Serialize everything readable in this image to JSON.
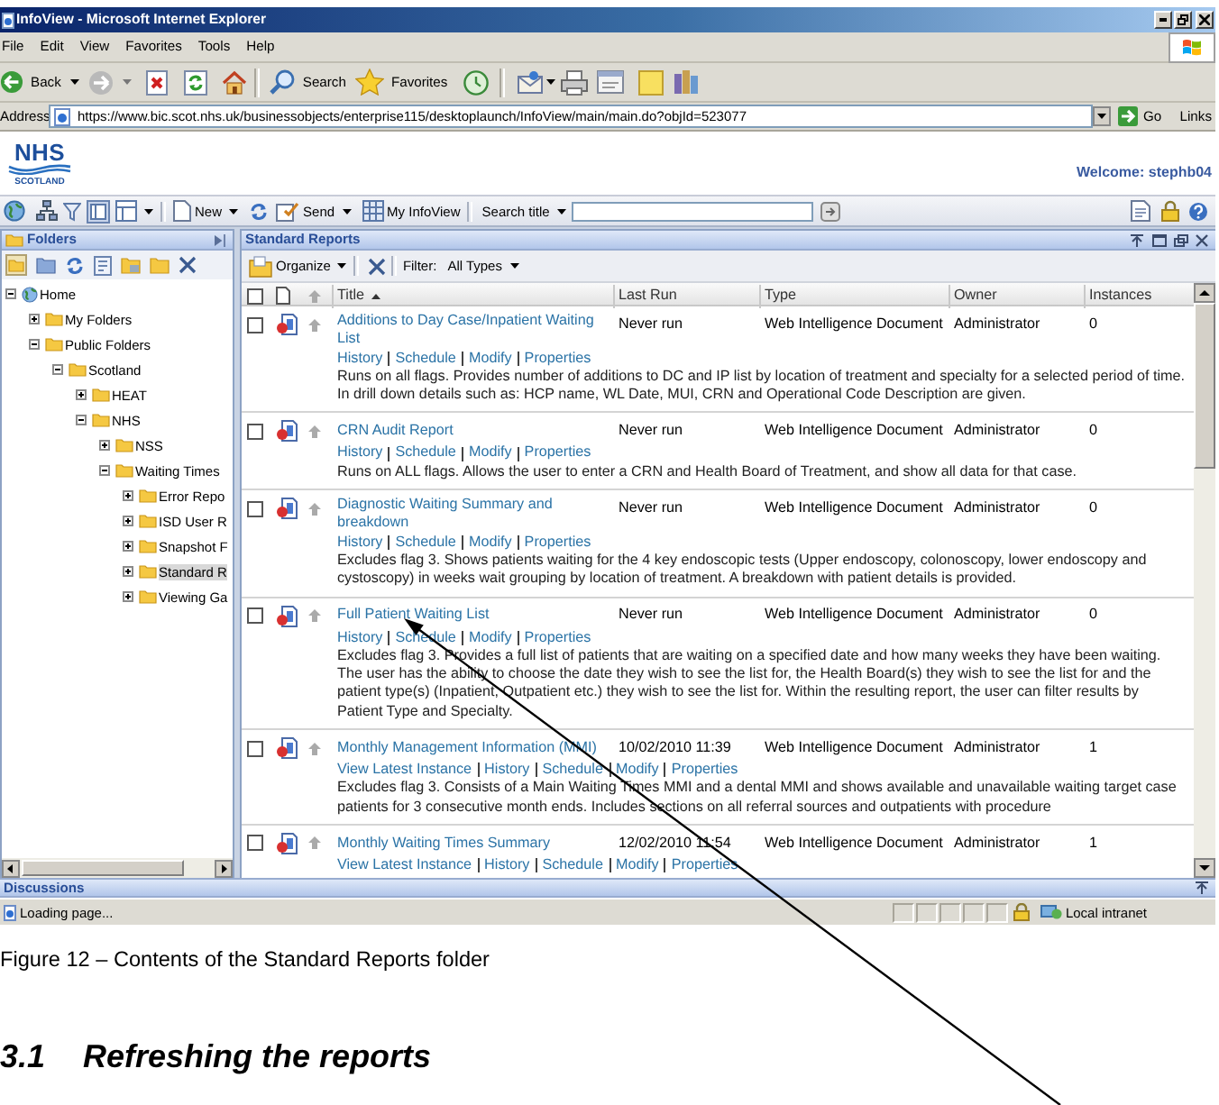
{
  "window": {
    "title": "InfoView - Microsoft Internet Explorer"
  },
  "menu": [
    "File",
    "Edit",
    "View",
    "Favorites",
    "Tools",
    "Help"
  ],
  "toolbar": {
    "back": "Back",
    "search": "Search",
    "favorites": "Favorites"
  },
  "address_bar": {
    "label": "Address",
    "url": "https://www.bic.scot.nhs.uk/businessobjects/enterprise115/desktoplaunch/InfoView/main/main.do?objId=523077",
    "go": "Go",
    "links": "Links"
  },
  "header": {
    "logo": "NHS",
    "logo_region": "SCOTLAND",
    "welcome": "Welcome: stephb04"
  },
  "app_toolbar": {
    "new": "New",
    "send": "Send",
    "my_infoview": "My InfoView",
    "search_label": "Search title"
  },
  "folders": {
    "title": "Folders",
    "tree": [
      {
        "label": "Home",
        "kind": "home",
        "expanded": true,
        "selected": false,
        "children": [
          {
            "label": "My Folders",
            "kind": "folder",
            "expanded": false,
            "selected": false
          },
          {
            "label": "Public Folders",
            "kind": "folder",
            "expanded": true,
            "selected": false,
            "children": [
              {
                "label": "Scotland",
                "kind": "folder",
                "expanded": true,
                "selected": false,
                "children": [
                  {
                    "label": "HEAT",
                    "kind": "folder",
                    "expanded": false,
                    "selected": false
                  },
                  {
                    "label": "NHS",
                    "kind": "folder",
                    "expanded": true,
                    "selected": false,
                    "children": [
                      {
                        "label": "NSS",
                        "kind": "folder",
                        "expanded": false,
                        "selected": false
                      },
                      {
                        "label": "Waiting Times",
                        "kind": "folder",
                        "expanded": true,
                        "selected": false,
                        "children": [
                          {
                            "label": "Error Repo",
                            "kind": "folder",
                            "expanded": false,
                            "selected": false
                          },
                          {
                            "label": "ISD User R",
                            "kind": "folder",
                            "expanded": false,
                            "selected": false
                          },
                          {
                            "label": "Snapshot F",
                            "kind": "folder",
                            "expanded": false,
                            "selected": false
                          },
                          {
                            "label": "Standard R",
                            "kind": "folder",
                            "expanded": false,
                            "selected": true
                          },
                          {
                            "label": "Viewing Ga",
                            "kind": "folder",
                            "expanded": false,
                            "selected": false
                          }
                        ]
                      }
                    ]
                  }
                ]
              }
            ]
          }
        ]
      }
    ]
  },
  "reports": {
    "title": "Standard Reports",
    "organize": "Organize",
    "filter_label": "Filter:",
    "filter_value": "All Types",
    "all_checked": false,
    "columns": [
      {
        "label": "Title",
        "sorted": true
      },
      {
        "label": "Last Run",
        "sorted": false
      },
      {
        "label": "Type",
        "sorted": false
      },
      {
        "label": "Owner",
        "sorted": false
      },
      {
        "label": "Instances",
        "sorted": false
      }
    ],
    "rows": [
      {
        "title": "Additions to Day Case/Inpatient Waiting List",
        "last_run": "Never run",
        "type": "Web Intelligence Document",
        "owner": "Administrator",
        "instances": "0",
        "checked": false,
        "actions": [
          "History",
          "Schedule",
          "Modify",
          "Properties"
        ],
        "description": "Runs on all flags. Provides number of additions to DC and IP list by location of treatment and specialty for a selected period of time. In drill down details such as: HCP name, WL Date, MUI, CRN and Operational Code Description are given."
      },
      {
        "title": "CRN Audit Report",
        "last_run": "Never run",
        "type": "Web Intelligence Document",
        "owner": "Administrator",
        "instances": "0",
        "checked": false,
        "actions": [
          "History",
          "Schedule",
          "Modify",
          "Properties"
        ],
        "description": "Runs on ALL flags. Allows the user to enter a CRN and Health Board of Treatment, and show all data for that case."
      },
      {
        "title": "Diagnostic Waiting Summary and breakdown",
        "last_run": "Never run",
        "type": "Web Intelligence Document",
        "owner": "Administrator",
        "instances": "0",
        "checked": false,
        "actions": [
          "History",
          "Schedule",
          "Modify",
          "Properties"
        ],
        "description": "Excludes flag 3. Shows patients waiting for the 4 key endoscopic tests (Upper endoscopy, colonoscopy, lower endoscopy and cystoscopy) in weeks wait grouping by location of treatment. A breakdown with patient details is provided."
      },
      {
        "title": "Full Patient Waiting List",
        "last_run": "Never run",
        "type": "Web Intelligence Document",
        "owner": "Administrator",
        "instances": "0",
        "checked": false,
        "actions": [
          "History",
          "Schedule",
          "Modify",
          "Properties"
        ],
        "description": "Excludes flag 3. Provides a full list of patients that are waiting on a specified date and how many weeks they have been waiting. The user has the ability to choose the date they wish to see the list for, the Health Board(s) they wish to see the list for and the patient type(s) (Inpatient, Outpatient etc.) they wish to see the list for. Within the resulting report, the user can filter results by Patient Type and Specialty."
      },
      {
        "title": "Monthly Management Information (MMI)",
        "last_run": "10/02/2010 11:39",
        "type": "Web Intelligence Document",
        "owner": "Administrator",
        "instances": "1",
        "checked": false,
        "actions": [
          "View Latest Instance",
          "History",
          "Schedule",
          "Modify",
          "Properties"
        ],
        "description": "Excludes flag 3. Consists of a Main Waiting Times MMI and a dental MMI and shows available and unavailable waiting target case patients for 3 consecutive month ends. Includes sections on all referral sources and outpatients with procedure"
      },
      {
        "title": "Monthly Waiting Times Summary",
        "last_run": "12/02/2010 11:54",
        "type": "Web Intelligence Document",
        "owner": "Administrator",
        "instances": "1",
        "checked": false,
        "actions": [
          "View Latest Instance",
          "History",
          "Schedule",
          "Modify",
          "Properties"
        ]
      }
    ]
  },
  "discussions": {
    "title": "Discussions"
  },
  "status_bar": {
    "text": "Loading page...",
    "zone": "Local intranet"
  },
  "caption": "Figure 12 – Contents of the Standard Reports folder",
  "heading": {
    "number": "3.1",
    "title": "Refreshing the reports"
  }
}
